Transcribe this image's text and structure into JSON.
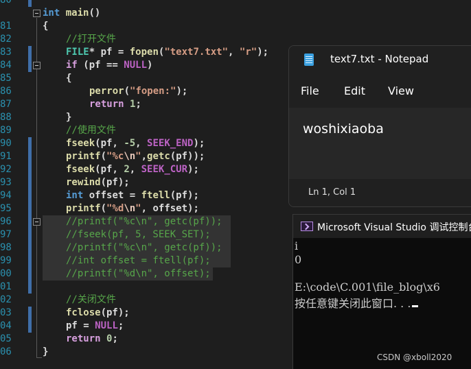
{
  "editor": {
    "lines": [
      {
        "num": "80"
      },
      {
        "num": "81"
      },
      {
        "num": "82"
      },
      {
        "num": "83"
      },
      {
        "num": "84"
      },
      {
        "num": "85"
      },
      {
        "num": "86"
      },
      {
        "num": "87"
      },
      {
        "num": "88"
      },
      {
        "num": "89"
      },
      {
        "num": "90"
      },
      {
        "num": "91"
      },
      {
        "num": "92"
      },
      {
        "num": "93"
      },
      {
        "num": "94"
      },
      {
        "num": "95"
      },
      {
        "num": "96"
      },
      {
        "num": "97"
      },
      {
        "num": "98"
      },
      {
        "num": "99"
      },
      {
        "num": "00"
      },
      {
        "num": "01"
      },
      {
        "num": "02"
      },
      {
        "num": "03"
      },
      {
        "num": "04"
      },
      {
        "num": "05"
      },
      {
        "num": "06"
      },
      {
        "num": "07"
      }
    ],
    "code": {
      "l81_kw": "int",
      "l81_fn": " main",
      "l81_rest": "()",
      "l82": "{",
      "l83": "//打开文件",
      "l84_ty": "FILE",
      "l84_a": "* pf = ",
      "l84_fn": "fopen",
      "l84_b": "(",
      "l84_s1": "\"text7.txt\"",
      "l84_c": ", ",
      "l84_s2": "\"r\"",
      "l84_d": ");",
      "l85_kw": "if",
      "l85_a": " (pf == ",
      "l85_mac": "NULL",
      "l85_b": ")",
      "l86": "{",
      "l87_fn": "perror",
      "l87_a": "(",
      "l87_s": "\"fopen:\"",
      "l87_b": ");",
      "l88_kw": "return",
      "l88_a": " ",
      "l88_num": "1",
      "l88_b": ";",
      "l89": "}",
      "l90": "//使用文件",
      "l91_fn": "fseek",
      "l91_a": "(pf, ",
      "l91_num": "-5",
      "l91_b": ", ",
      "l91_mac": "SEEK_END",
      "l91_c": ");",
      "l92_fn": "printf",
      "l92_a": "(",
      "l92_s1": "\"%c",
      "l92_esc": "\\n",
      "l92_s2": "\"",
      "l92_b": ",",
      "l92_fn2": "getc",
      "l92_c": "(pf));",
      "l93_fn": "fseek",
      "l93_a": "(pf, ",
      "l93_num": "2",
      "l93_b": ", ",
      "l93_mac": "SEEK_CUR",
      "l93_c": ");",
      "l94_fn": "rewind",
      "l94_a": "(pf);",
      "l95_kw": "int",
      "l95_a": " offset = ",
      "l95_fn": "ftell",
      "l95_b": "(pf);",
      "l96_fn": "printf",
      "l96_a": "(",
      "l96_s1": "\"%d",
      "l96_esc": "\\n",
      "l96_s2": "\"",
      "l96_b": ", offset);",
      "l97": "//printf(\"%c\\n\", getc(pf));",
      "l98": "//fseek(pf, 5, SEEK_SET);",
      "l99": "//printf(\"%c\\n\", getc(pf));",
      "l00": "//int offset = ftell(pf);",
      "l01": "//printf(\"%d\\n\", offset);",
      "l03": "//关闭文件",
      "l04_fn": "fclose",
      "l04_a": "(pf);",
      "l05_a": "pf = ",
      "l05_mac": "NULL",
      "l05_b": ";",
      "l06_kw": "return",
      "l06_a": " ",
      "l06_num": "0",
      "l06_b": ";",
      "l07": "}"
    }
  },
  "notepad": {
    "title": "text7.txt - Notepad",
    "icon": "notepad-icon",
    "menu": [
      "File",
      "Edit",
      "View"
    ],
    "content": "woshixiaoba",
    "status": "Ln 1, Col 1"
  },
  "console": {
    "title": "Microsoft Visual Studio 调试控制台",
    "icon": "terminal-icon",
    "lines": [
      "i",
      "0",
      "",
      "E:\\code\\C.001\\file_blog\\x6",
      "按任意键关闭此窗口. . ."
    ]
  },
  "watermark": "CSDN @xboll2020"
}
